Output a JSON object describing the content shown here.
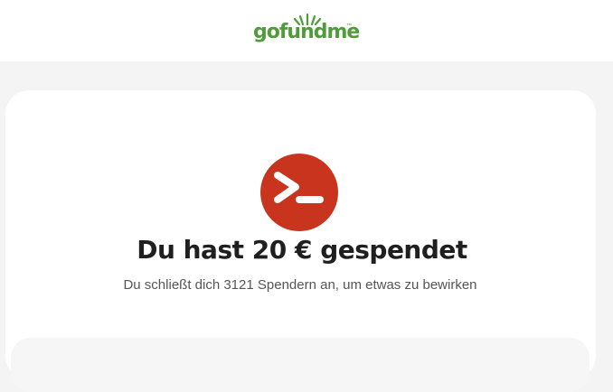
{
  "header": {
    "logo_text": "gofundme",
    "logo_trademark": "™"
  },
  "confirmation": {
    "avatar_icon": "terminal-prompt-icon",
    "headline": "Du hast 20 € gespendet",
    "subline": "Du schließt dich 3121 Spendern an, um etwas zu bewirken"
  },
  "colors": {
    "brand_green": "#4f9d3a",
    "avatar_bg": "#c9341e",
    "page_bg": "#f4f4f4"
  }
}
